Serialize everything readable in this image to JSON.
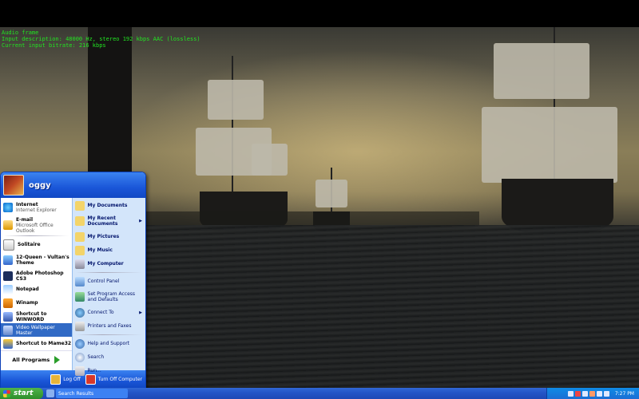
{
  "overlay": {
    "lines": [
      "Audio frame",
      "Input description: 48000 Hz, stereo 192 kbps AAC (lossless)",
      "Current input bitrate: 216 kbps"
    ]
  },
  "start_menu": {
    "user_name": "oggy",
    "left_items": [
      {
        "title": "Internet",
        "subtitle": "Internet Explorer",
        "icon": "internet-explorer-icon"
      },
      {
        "title": "E-mail",
        "subtitle": "Microsoft Office Outlook",
        "icon": "outlook-icon"
      },
      {
        "title": "Solitaire",
        "subtitle": "",
        "icon": "solitaire-icon"
      },
      {
        "title": "12-Queen - Vultan's Theme",
        "subtitle": "",
        "icon": "media-file-icon"
      },
      {
        "title": "Adobe Photoshop CS3",
        "subtitle": "",
        "icon": "photoshop-icon"
      },
      {
        "title": "Notepad",
        "subtitle": "",
        "icon": "notepad-icon"
      },
      {
        "title": "Winamp",
        "subtitle": "",
        "icon": "winamp-icon"
      },
      {
        "title": "Shortcut to WINWORD",
        "subtitle": "",
        "icon": "word-icon"
      },
      {
        "title": "Video Wallpaper Master",
        "subtitle": "",
        "icon": "video-wallpaper-icon"
      },
      {
        "title": "Shortcut to Mame32",
        "subtitle": "",
        "icon": "mame-icon"
      }
    ],
    "all_programs": "All Programs",
    "right_items": [
      {
        "label": "My Documents",
        "icon": "folder-documents-icon"
      },
      {
        "label": "My Recent Documents",
        "icon": "recent-documents-icon"
      },
      {
        "label": "My Pictures",
        "icon": "folder-pictures-icon"
      },
      {
        "label": "My Music",
        "icon": "folder-music-icon"
      },
      {
        "label": "My Computer",
        "icon": "computer-icon"
      },
      {
        "label": "Control Panel",
        "icon": "control-panel-icon"
      },
      {
        "label": "Set Program Access and Defaults",
        "icon": "program-defaults-icon"
      },
      {
        "label": "Connect To",
        "icon": "network-icon"
      },
      {
        "label": "Printers and Faxes",
        "icon": "printer-icon"
      },
      {
        "label": "Help and Support",
        "icon": "help-icon"
      },
      {
        "label": "Search",
        "icon": "search-icon"
      },
      {
        "label": "Run...",
        "icon": "run-icon"
      }
    ],
    "log_off": "Log Off",
    "turn_off": "Turn Off Computer"
  },
  "taskbar": {
    "start_label": "start",
    "task_label": "Search Results",
    "clock": "7:27 PM"
  },
  "colors": {
    "taskbar_blue": "#2456c8",
    "start_green": "#2f8f2a",
    "selection": "#316ac5",
    "overlay_text": "#22e322"
  }
}
